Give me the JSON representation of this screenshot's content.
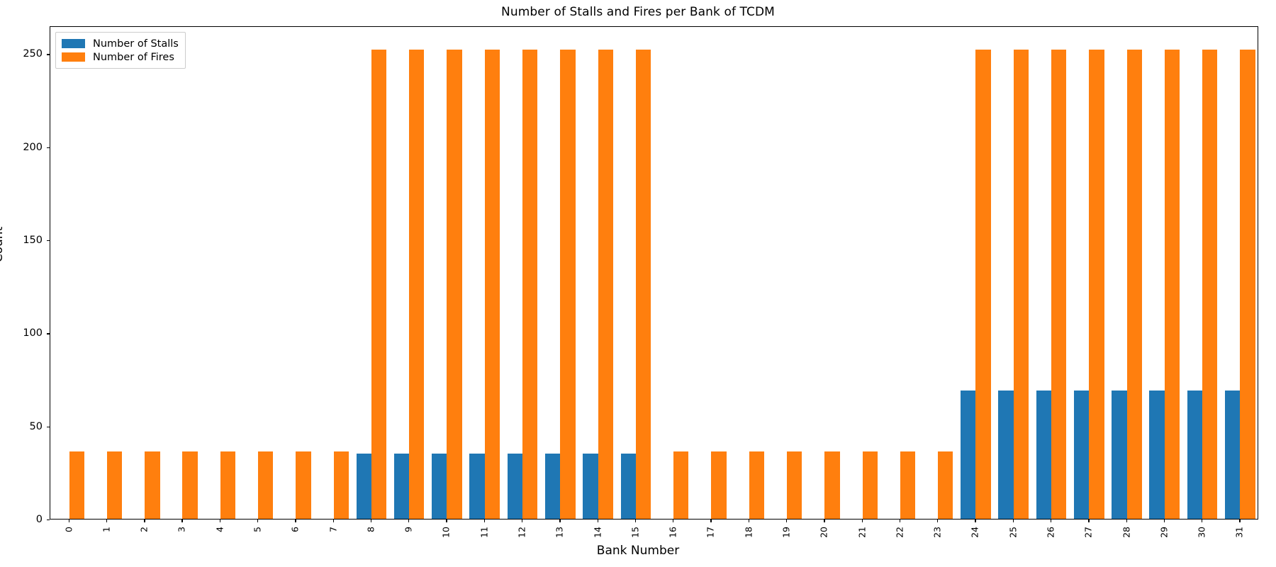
{
  "chart_data": {
    "type": "bar",
    "title": "Number of Stalls and Fires per Bank of TCDM",
    "xlabel": "Bank Number",
    "ylabel": "Count",
    "grid": false,
    "legend_position": "upper left",
    "ylim": [
      0,
      265
    ],
    "yticks": [
      0,
      50,
      100,
      150,
      200,
      250
    ],
    "ytick_labels": [
      "0",
      "50",
      "100",
      "150",
      "200",
      "250"
    ],
    "categories": [
      "0",
      "1",
      "2",
      "3",
      "4",
      "5",
      "6",
      "7",
      "8",
      "9",
      "10",
      "11",
      "12",
      "13",
      "14",
      "15",
      "16",
      "17",
      "18",
      "19",
      "20",
      "21",
      "22",
      "23",
      "24",
      "25",
      "26",
      "27",
      "28",
      "29",
      "30",
      "31"
    ],
    "series": [
      {
        "name": "Number of Stalls",
        "color": "#1f77b4",
        "values": [
          0,
          0,
          0,
          0,
          0,
          0,
          0,
          0,
          35,
          35,
          35,
          35,
          35,
          35,
          35,
          35,
          0,
          0,
          0,
          0,
          0,
          0,
          0,
          0,
          69,
          69,
          69,
          69,
          69,
          69,
          69,
          69
        ]
      },
      {
        "name": "Number of Fires",
        "color": "#ff7f0e",
        "values": [
          36,
          36,
          36,
          36,
          36,
          36,
          36,
          36,
          252,
          252,
          252,
          252,
          252,
          252,
          252,
          252,
          36,
          36,
          36,
          36,
          36,
          36,
          36,
          36,
          252,
          252,
          252,
          252,
          252,
          252,
          252,
          252
        ]
      }
    ]
  }
}
